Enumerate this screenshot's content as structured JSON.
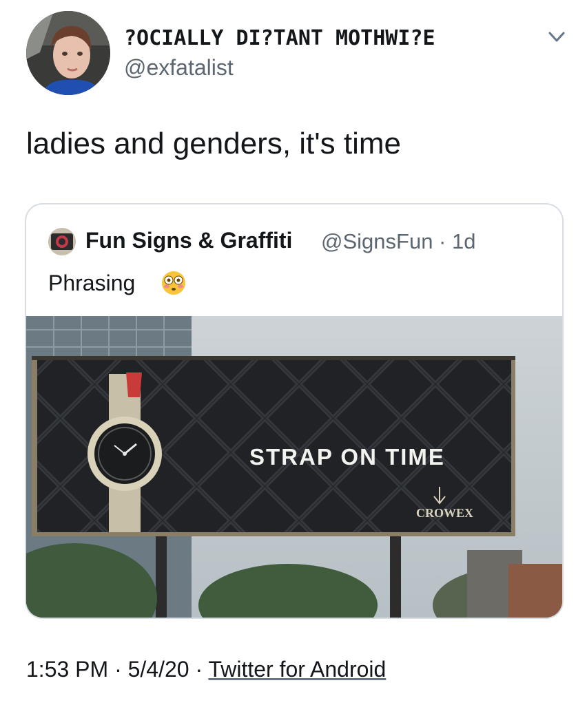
{
  "tweet": {
    "display_name": "?OCIALLY DI?TANT MOTHWI?E",
    "handle": "@exfatalist",
    "text": "ladies and genders, it's time",
    "menu_icon": "chevron-down-icon"
  },
  "quoted_tweet": {
    "name": "Fun Signs & Graffiti",
    "handle_time": "@SignsFun · 1d",
    "text": "Phrasing",
    "emoji": "flushed-face-emoji",
    "image": {
      "billboard_slogan": "STRAP ON TIME",
      "billboard_brand": "CROWEX"
    }
  },
  "footer": {
    "time_date": "1:53 PM · 5/4/20 · ",
    "source": "Twitter for Android"
  }
}
